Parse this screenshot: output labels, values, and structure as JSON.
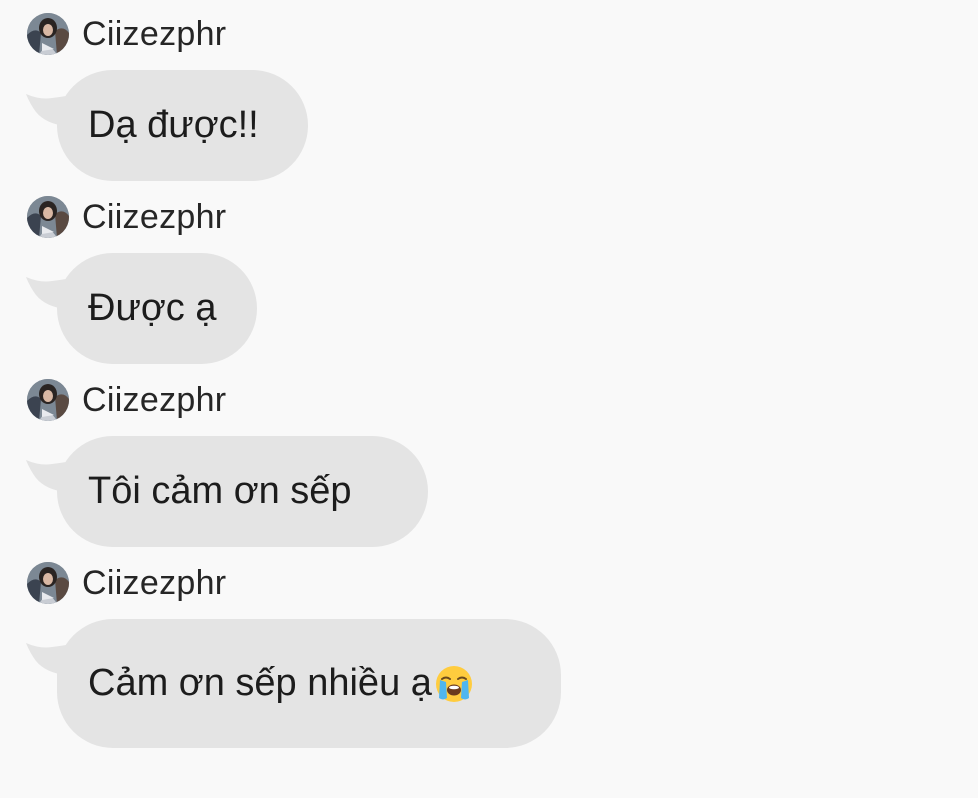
{
  "messages": [
    {
      "sender": "Ciizezphr",
      "text": "Dạ được!!"
    },
    {
      "sender": "Ciizezphr",
      "text": "Được ạ"
    },
    {
      "sender": "Ciizezphr",
      "text": "Tôi cảm ơn sếp"
    },
    {
      "sender": "Ciizezphr",
      "text": "Cảm ơn sếp nhiều ạ",
      "emoji": "loudly-crying-face"
    }
  ],
  "colors": {
    "background": "#f9f9f9",
    "bubble": "#e4e4e4",
    "text": "#1c1c1c"
  }
}
